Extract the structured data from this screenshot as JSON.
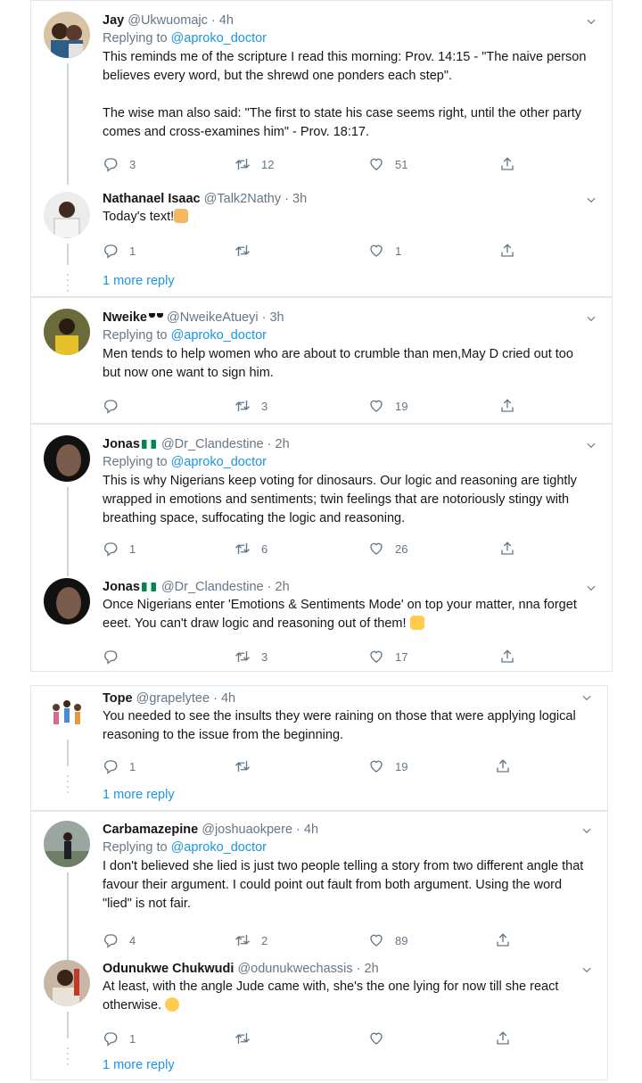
{
  "replying_label": "Replying to",
  "tweets": [
    {
      "name": "Jay",
      "handle": "@Ukwuomajc",
      "time": "4h",
      "reply_to": "@aproko_doctor",
      "body": "This reminds me of the scripture I read this morning: Prov. 14:15 - \"The naive person believes every word, but the shrewd one ponders each step\".\n\nThe wise man also said: \"The first to state his case seems right, until the other party comes and cross-examines him\" - Prov. 18:17.",
      "replies": "3",
      "retweets": "12",
      "likes": "51"
    },
    {
      "name": "Nathanael Isaac",
      "handle": "@Talk2Nathy",
      "time": "3h",
      "body": "Today's text!",
      "replies": "1",
      "retweets": "",
      "likes": "1",
      "more": "1 more reply"
    },
    {
      "name": "Nweike",
      "handle": "@NweikeAtueyi",
      "time": "3h",
      "reply_to": "@aproko_doctor",
      "body": "Men tends to help women who are about to crumble than men,May D cried out too but now one want to sign him.",
      "replies": "",
      "retweets": "3",
      "likes": "19"
    },
    {
      "name": "Jonas",
      "handle": "@Dr_Clandestine",
      "time": "2h",
      "reply_to": "@aproko_doctor",
      "body": "This is why Nigerians keep voting for dinosaurs. Our logic and reasoning are tightly wrapped in emotions and sentiments; twin feelings that are notoriously stingy with breathing space, suffocating the logic and reasoning.",
      "replies": "1",
      "retweets": "6",
      "likes": "26"
    },
    {
      "name": "Jonas",
      "handle": "@Dr_Clandestine",
      "time": "2h",
      "body": "Once Nigerians enter 'Emotions & Sentiments Mode' on top your matter, nna forget eeet. You can't draw logic and reasoning out of them!",
      "replies": "",
      "retweets": "3",
      "likes": "17"
    },
    {
      "name": "Tope",
      "handle": "@grapelytee",
      "time": "4h",
      "body": "You needed to see the insults they were raining on those that were applying logical reasoning to the issue from the beginning.",
      "replies": "1",
      "retweets": "",
      "likes": "19",
      "more": "1 more reply"
    },
    {
      "name": "Carbamazepine",
      "handle": "@joshuaokpere",
      "time": "4h",
      "reply_to": "@aproko_doctor",
      "body": "I don't believed she lied is just two people telling a story from two different angle that favour their argument. I could point out fault from both argument. Using the word \"lied\" is not fair.",
      "replies": "4",
      "retweets": "2",
      "likes": "89"
    },
    {
      "name": "Odunukwe Chukwudi",
      "handle": "@odunukwechassis",
      "time": "2h",
      "body": "At least, with the angle Jude came with, she's the one lying for now till she react otherwise.",
      "replies": "1",
      "retweets": "",
      "likes": "",
      "more": "1 more reply"
    }
  ],
  "colors": {
    "accent": "#1b95e0",
    "muted": "#657786",
    "text": "#14171a",
    "border": "#e1e8ed"
  },
  "icons": {
    "reply": "reply-icon",
    "retweet": "retweet-icon",
    "like": "heart-icon",
    "share": "share-icon",
    "menu": "chevron-down-icon"
  }
}
